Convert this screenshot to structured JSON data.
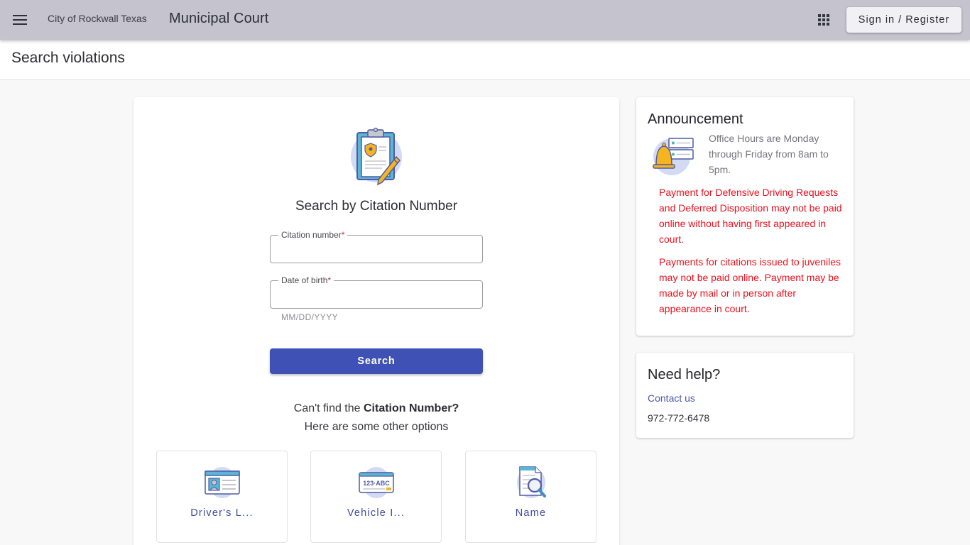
{
  "appbar": {
    "menu_icon": "hamburger-menu-icon",
    "org_name": "City of Rockwall Texas",
    "app_title": "Municipal Court",
    "apps_icon": "apps-grid-icon",
    "signin_label": "Sign in / Register"
  },
  "page": {
    "title": "Search violations"
  },
  "search": {
    "hero_icon": "clipboard-citation-icon",
    "heading": "Search by Citation Number",
    "citation_field": {
      "label": "Citation number",
      "required_mark": "*",
      "value": "",
      "placeholder": ""
    },
    "dob_field": {
      "label": "Date of birth",
      "required_mark": "*",
      "value": "",
      "placeholder": "",
      "hint": "MM/DD/YYYY"
    },
    "search_button": "Search",
    "cant_find_prefix": "Can't find the ",
    "cant_find_bold": "Citation Number?",
    "other_options": "Here are some other options"
  },
  "options": [
    {
      "label": "Driver's L...",
      "icon": "drivers-license-icon"
    },
    {
      "label": "Vehicle I...",
      "icon": "license-plate-icon"
    },
    {
      "label": "Name",
      "icon": "document-search-icon"
    }
  ],
  "announcement": {
    "title": "Announcement",
    "icon": "bell-notification-icon",
    "office_hours": "Office Hours are Monday through Friday from 8am to 5pm.",
    "notices": [
      "Payment for Defensive Driving Requests and Deferred Disposition may not be paid online without having first appeared in court.",
      "Payments for citations issued to juveniles may not be paid online. Payment may be made by mail or in person after appearance in court."
    ]
  },
  "help": {
    "title": "Need help?",
    "contact_label": "Contact us",
    "phone": "972-772-6478"
  },
  "colors": {
    "appbar_bg": "#c4c3ce",
    "primary": "#3f51b5",
    "notice_red": "#e8101d",
    "link": "#4d58a8"
  }
}
